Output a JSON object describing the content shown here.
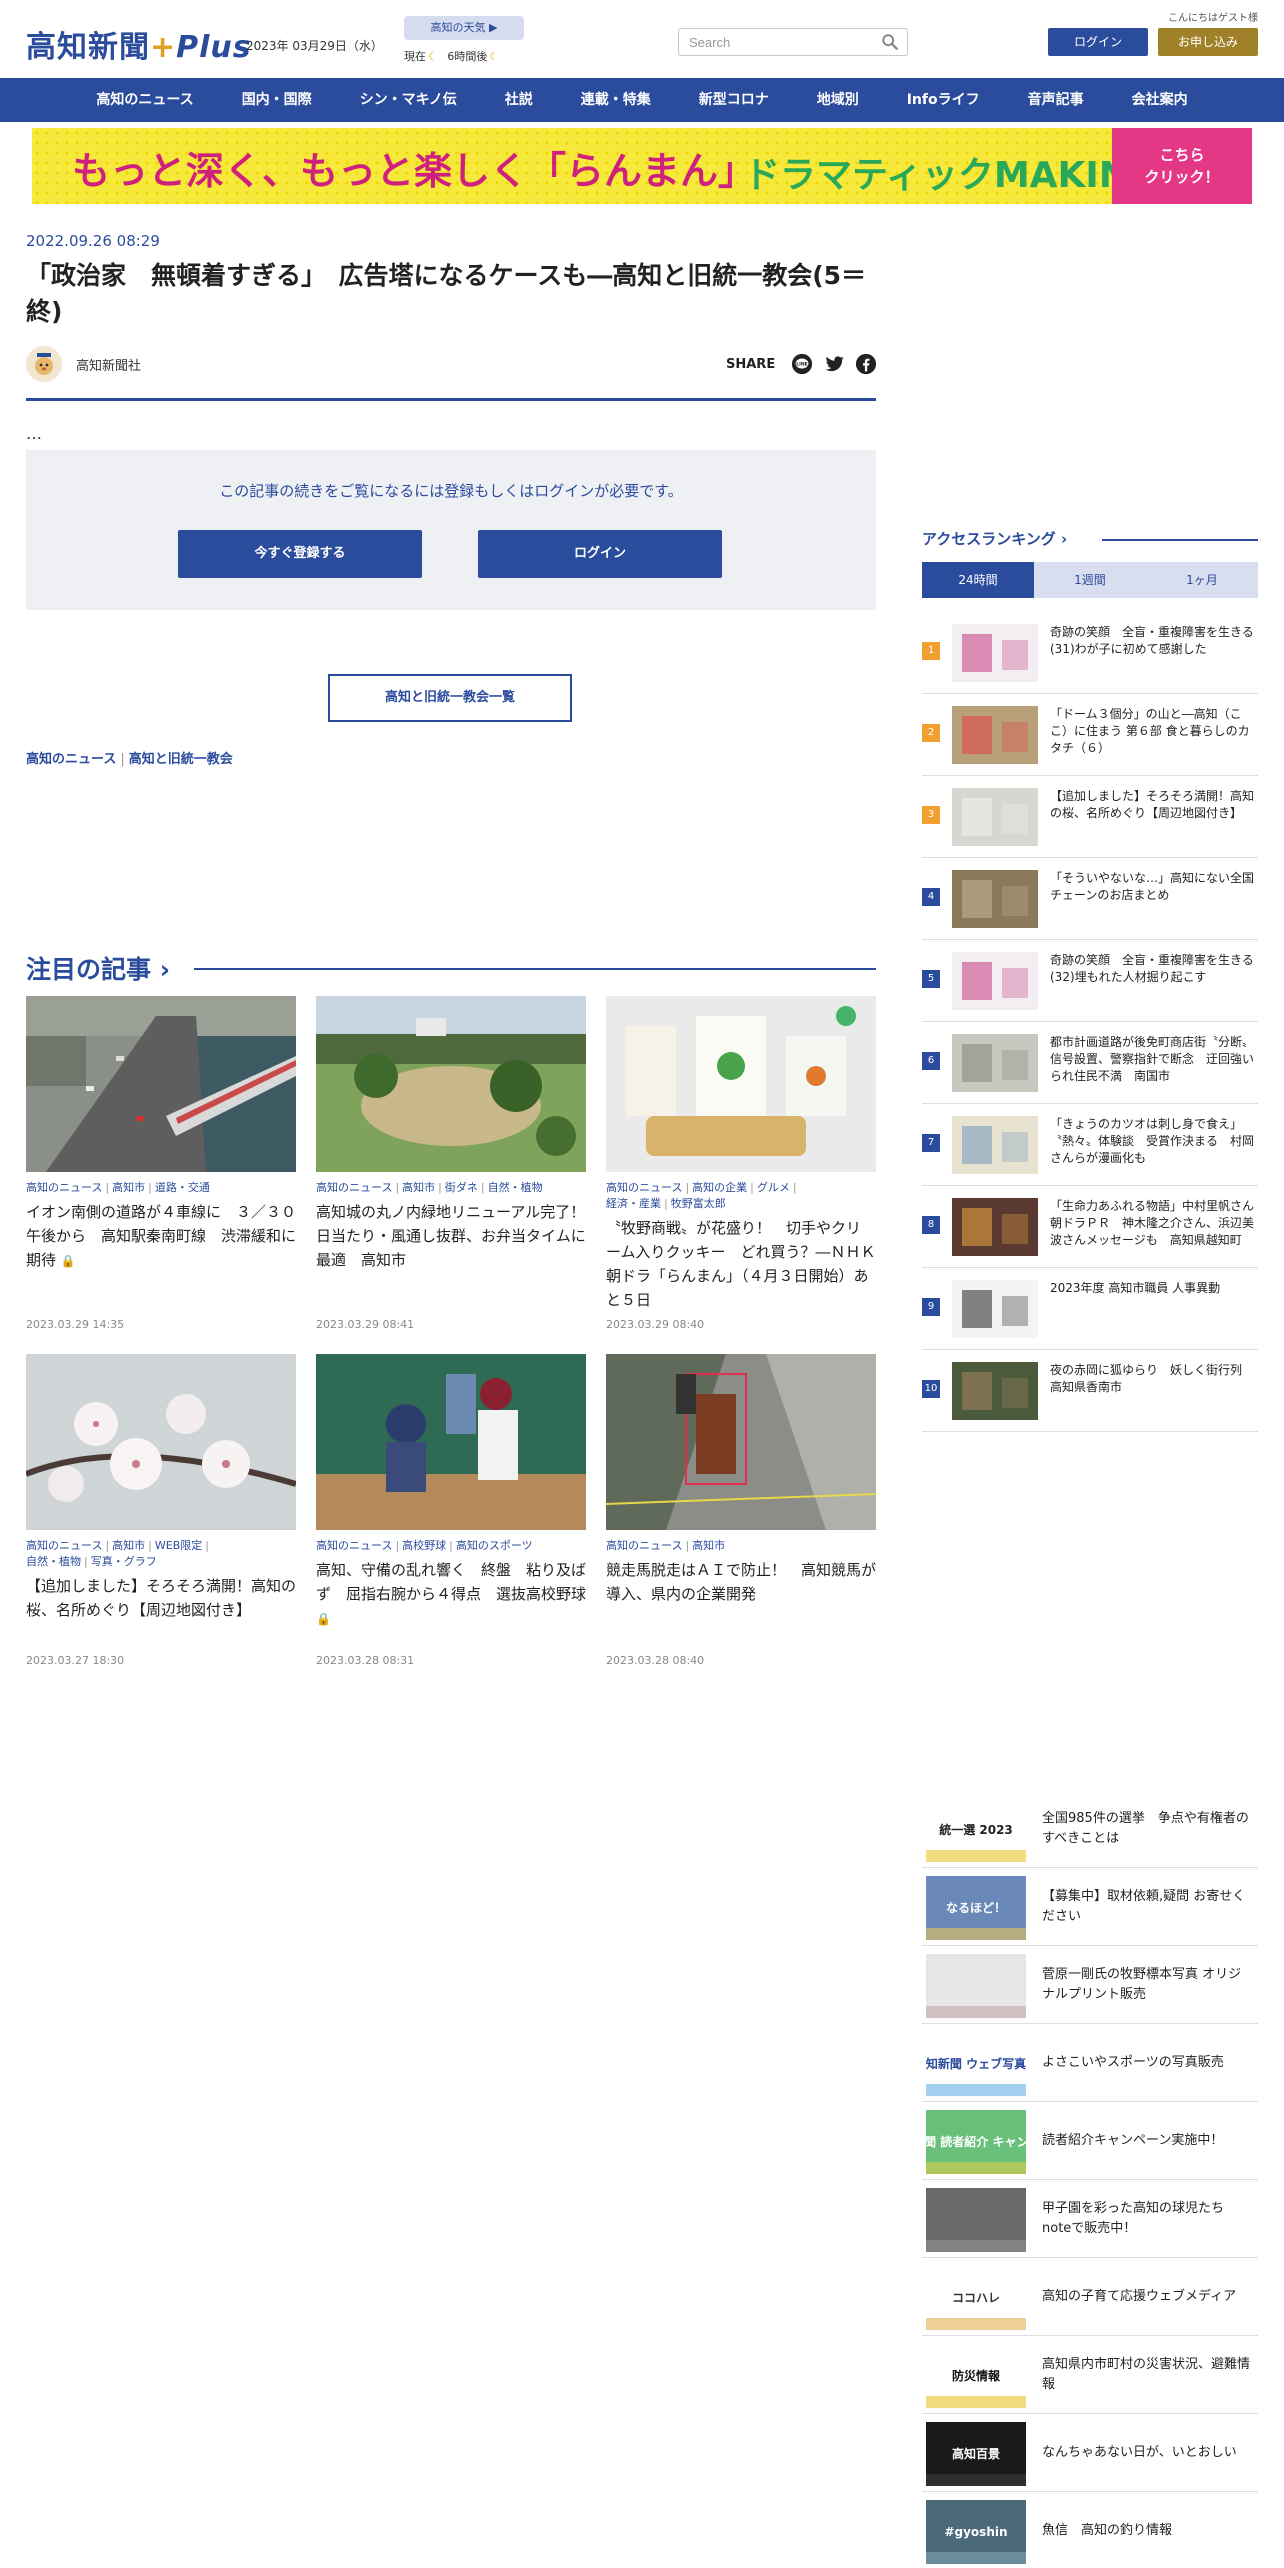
{
  "header": {
    "logo_main": "高知新聞",
    "logo_plus": "Plus",
    "date": "2023年 03月29日（水）",
    "weather_button": "高知の天気 ▶",
    "weather_now_label": "現在",
    "weather_later_label": "6時間後",
    "search_placeholder": "Search",
    "greeting": "こんにちはゲスト様",
    "login_label": "ログイン",
    "apply_label": "お申し込み"
  },
  "nav": {
    "items": [
      "高知のニュース",
      "国内・国際",
      "シン・マキノ伝",
      "社説",
      "連載・特集",
      "新型コロナ",
      "地域別",
      "Infoライフ",
      "音声記事",
      "会社案内"
    ]
  },
  "banner": {
    "main": "もっと深く、もっと楽しく「らんまん」",
    "sub": "ドラマティックMAKINO!",
    "click_line1": "こちら",
    "click_line2": "クリック！"
  },
  "article": {
    "date": "2022.09.26 08:29",
    "title": "「政治家　無頓着すぎる」　広告塔になるケースも―高知と旧統一教会(5＝終)",
    "author": "高知新聞社",
    "share_label": "SHARE",
    "ellipsis": "…",
    "paywall_message": "この記事の続きをご覧になるには登録もしくはログインが必要です。",
    "register_button": "今すぐ登録する",
    "login_button": "ログイン",
    "series_button": "高知と旧統一教会一覧",
    "tags": [
      "高知のニュース",
      "高知と旧統一教会"
    ]
  },
  "featured": {
    "heading": "注目の記事",
    "cards": [
      {
        "cats": [
          "高知のニュース",
          "高知市",
          "道路・交通"
        ],
        "title": "イオン南側の道路が４車線に　３／３０午後から　高知駅秦南町線　渋滞緩和に期待",
        "locked": true,
        "date": "2023.03.29 14:35"
      },
      {
        "cats": [
          "高知のニュース",
          "高知市",
          "街ダネ",
          "自然・植物"
        ],
        "title": "高知城の丸ノ内緑地リニューアル完了！　日当たり・風通し抜群、お弁当タイムに最適　高知市",
        "locked": false,
        "date": "2023.03.29 08:41"
      },
      {
        "cats": [
          "高知のニュース",
          "高知の企業",
          "グルメ",
          "経済・産業",
          "牧野富太郎"
        ],
        "title": "〝牧野商戦〟が花盛り！　切手やクリーム入りクッキー　どれ買う？―ＮＨＫ朝ドラ「らんまん」（４月３日開始）あと５日",
        "locked": false,
        "date": "2023.03.29 08:40"
      },
      {
        "cats": [
          "高知のニュース",
          "高知市",
          "WEB限定",
          "自然・植物",
          "写真・グラフ"
        ],
        "title": "【追加しました】そろそろ満開！高知の桜、名所めぐり【周辺地図付き】",
        "locked": false,
        "date": "2023.03.27 18:30"
      },
      {
        "cats": [
          "高知のニュース",
          "高校野球",
          "高知のスポーツ"
        ],
        "title": "高知、守備の乱れ響く　終盤　粘り及ばず　屈指右腕から４得点　選抜高校野球",
        "locked": true,
        "date": "2023.03.28 08:31"
      },
      {
        "cats": [
          "高知のニュース",
          "高知市"
        ],
        "title": "競走馬脱走はＡＩで防止！　高知競馬が導入、県内の企業開発",
        "locked": false,
        "date": "2023.03.28 08:40"
      }
    ]
  },
  "ranking": {
    "heading": "アクセスランキング",
    "tabs": [
      "24時間",
      "1週間",
      "1ヶ月"
    ],
    "items": [
      {
        "num": "1",
        "title": "奇跡の笑顔　全盲・重複障害を生きる(31)わが子に初めて感謝した"
      },
      {
        "num": "2",
        "title": "「ドーム３個分」の山と―高知（ここ）に住まう 第６部 食と暮らしのカタチ（６）"
      },
      {
        "num": "3",
        "title": "【追加しました】そろそろ満開！高知の桜、名所めぐり【周辺地図付き】"
      },
      {
        "num": "4",
        "title": "「そういやないな…」高知にない全国チェーンのお店まとめ"
      },
      {
        "num": "5",
        "title": "奇跡の笑顔　全盲・重複障害を生きる(32)埋もれた人材掘り起こす"
      },
      {
        "num": "6",
        "title": "都市計画道路が後免町商店街〝分断〟　信号設置、警察指針で断念　迂回強いられ住民不満　南国市"
      },
      {
        "num": "7",
        "title": "「きょうのカツオは刺し身で食え」〝熱々〟体験談　受賞作決まる　村岡さんらが漫画化も"
      },
      {
        "num": "8",
        "title": "「生命力あふれる物語」中村里帆さん朝ドラＰＲ　神木隆之介さん、浜辺美波さんメッセージも　高知県越知町"
      },
      {
        "num": "9",
        "title": "2023年度 高知市職員 人事異動"
      },
      {
        "num": "10",
        "title": "夜の赤岡に狐ゆらり　妖しく街行列　高知県香南市"
      }
    ]
  },
  "side_links": [
    {
      "title": "全国985件の選挙　争点や有権者のすべきことは",
      "thumb_text": "統一選 2023"
    },
    {
      "title": "【募集中】取材依頼,疑問 お寄せください",
      "thumb_text": "なるほど！"
    },
    {
      "title": "菅原一剛氏の牧野標本写真 オリジナルプリント販売",
      "thumb_text": ""
    },
    {
      "title": "よさこいやスポーツの写真販売",
      "thumb_text": "高知新聞 ウェブ写真館"
    },
    {
      "title": "読者紹介キャンペーン実施中！",
      "thumb_text": "高知新聞 読者紹介 キャンペーン"
    },
    {
      "title": "甲子園を彩った高知の球児たち noteで販売中！",
      "thumb_text": ""
    },
    {
      "title": "高知の子育て応援ウェブメディア",
      "thumb_text": "ココハレ"
    },
    {
      "title": "高知県内市町村の災害状況、避難情報",
      "thumb_text": "防災情報"
    },
    {
      "title": "なんちゃあない日が、いとおしい",
      "thumb_text": "高知百景"
    },
    {
      "title": "魚信　高知の釣り情報",
      "thumb_text": "#gyoshin"
    }
  ],
  "colors": {
    "brand_blue": "#2b4c9c",
    "gold": "#a0812a",
    "banner_yellow": "#f7e93c",
    "banner_pink": "#e43886",
    "rank_orange": "#f0a030"
  }
}
